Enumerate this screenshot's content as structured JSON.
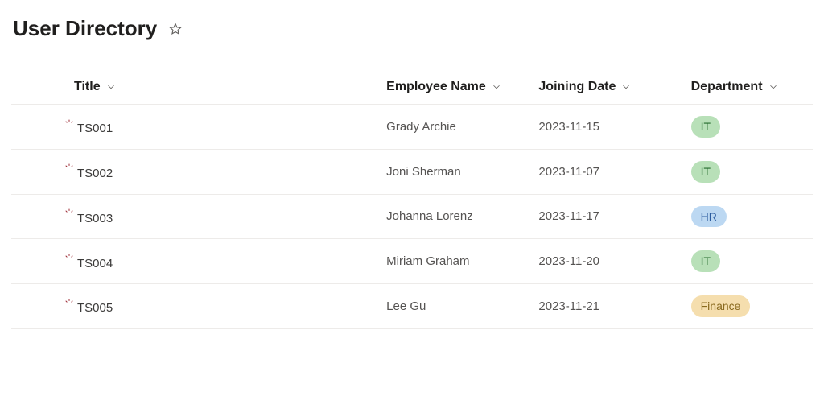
{
  "header": {
    "title": "User Directory"
  },
  "columns": {
    "title": "Title",
    "employee": "Employee Name",
    "joining": "Joining Date",
    "department": "Department"
  },
  "rows": [
    {
      "title": "TS001",
      "employee": "Grady Archie",
      "joining": "2023-11-15",
      "department": "IT",
      "deptClass": "IT"
    },
    {
      "title": "TS002",
      "employee": "Joni Sherman",
      "joining": "2023-11-07",
      "department": "IT",
      "deptClass": "IT"
    },
    {
      "title": "TS003",
      "employee": "Johanna Lorenz",
      "joining": "2023-11-17",
      "department": "HR",
      "deptClass": "HR"
    },
    {
      "title": "TS004",
      "employee": "Miriam Graham",
      "joining": "2023-11-20",
      "department": "IT",
      "deptClass": "IT"
    },
    {
      "title": "TS005",
      "employee": "Lee Gu",
      "joining": "2023-11-21",
      "department": "Finance",
      "deptClass": "Finance"
    }
  ]
}
